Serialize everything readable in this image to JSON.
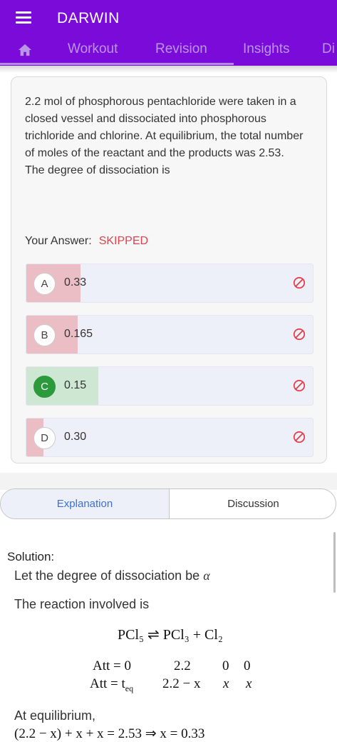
{
  "header": {
    "menu_icon": "hamburger-menu-icon",
    "title": "DARWIN",
    "tabs": [
      {
        "icon": "home-icon",
        "label": ""
      },
      {
        "label": "Workout"
      },
      {
        "label": "Revision"
      },
      {
        "label": "Insights"
      },
      {
        "label": "Di"
      }
    ],
    "bar_color": "#7b0bd9"
  },
  "question": {
    "text": "2.2 mol of phosphorous pentachloride were taken in a closed vessel and dissociated into phosphorous trichloride and chlorine. At equilibrium, the total number of moles of the reactant and the products was 2.53. The degree of dissociation is",
    "your_answer_label": "Your Answer:",
    "your_answer_value": "SKIPPED",
    "options": [
      {
        "letter": "A",
        "value": "0.33",
        "fill_percent": 19,
        "correct": false
      },
      {
        "letter": "B",
        "value": "0.165",
        "fill_percent": 18,
        "correct": false
      },
      {
        "letter": "C",
        "value": "0.15",
        "fill_percent": 25,
        "correct": true
      },
      {
        "letter": "D",
        "value": "0.30",
        "fill_percent": 6,
        "correct": false
      }
    ],
    "option_icon": "ban-icon"
  },
  "tabs2": {
    "explanation": "Explanation",
    "discussion": "Discussion"
  },
  "solution": {
    "label": "Solution:",
    "line1": "Let the degree of dissociation be",
    "alpha": "α",
    "line2": "The reaction involved is",
    "reaction": "PCl₅ ⇌ PCl₃ + Cl₂",
    "row1_label": "Att = 0",
    "row1_vals": [
      "2.2",
      "0",
      "0"
    ],
    "row2_label": "Att = t",
    "row2_sub": "eq",
    "row2_vals": [
      "2.2 − x",
      "x",
      "x"
    ],
    "line3": "At equilibrium,",
    "line4": "(2.2 − x) + x + x = 2.53 ⇒ x = 0.33"
  }
}
